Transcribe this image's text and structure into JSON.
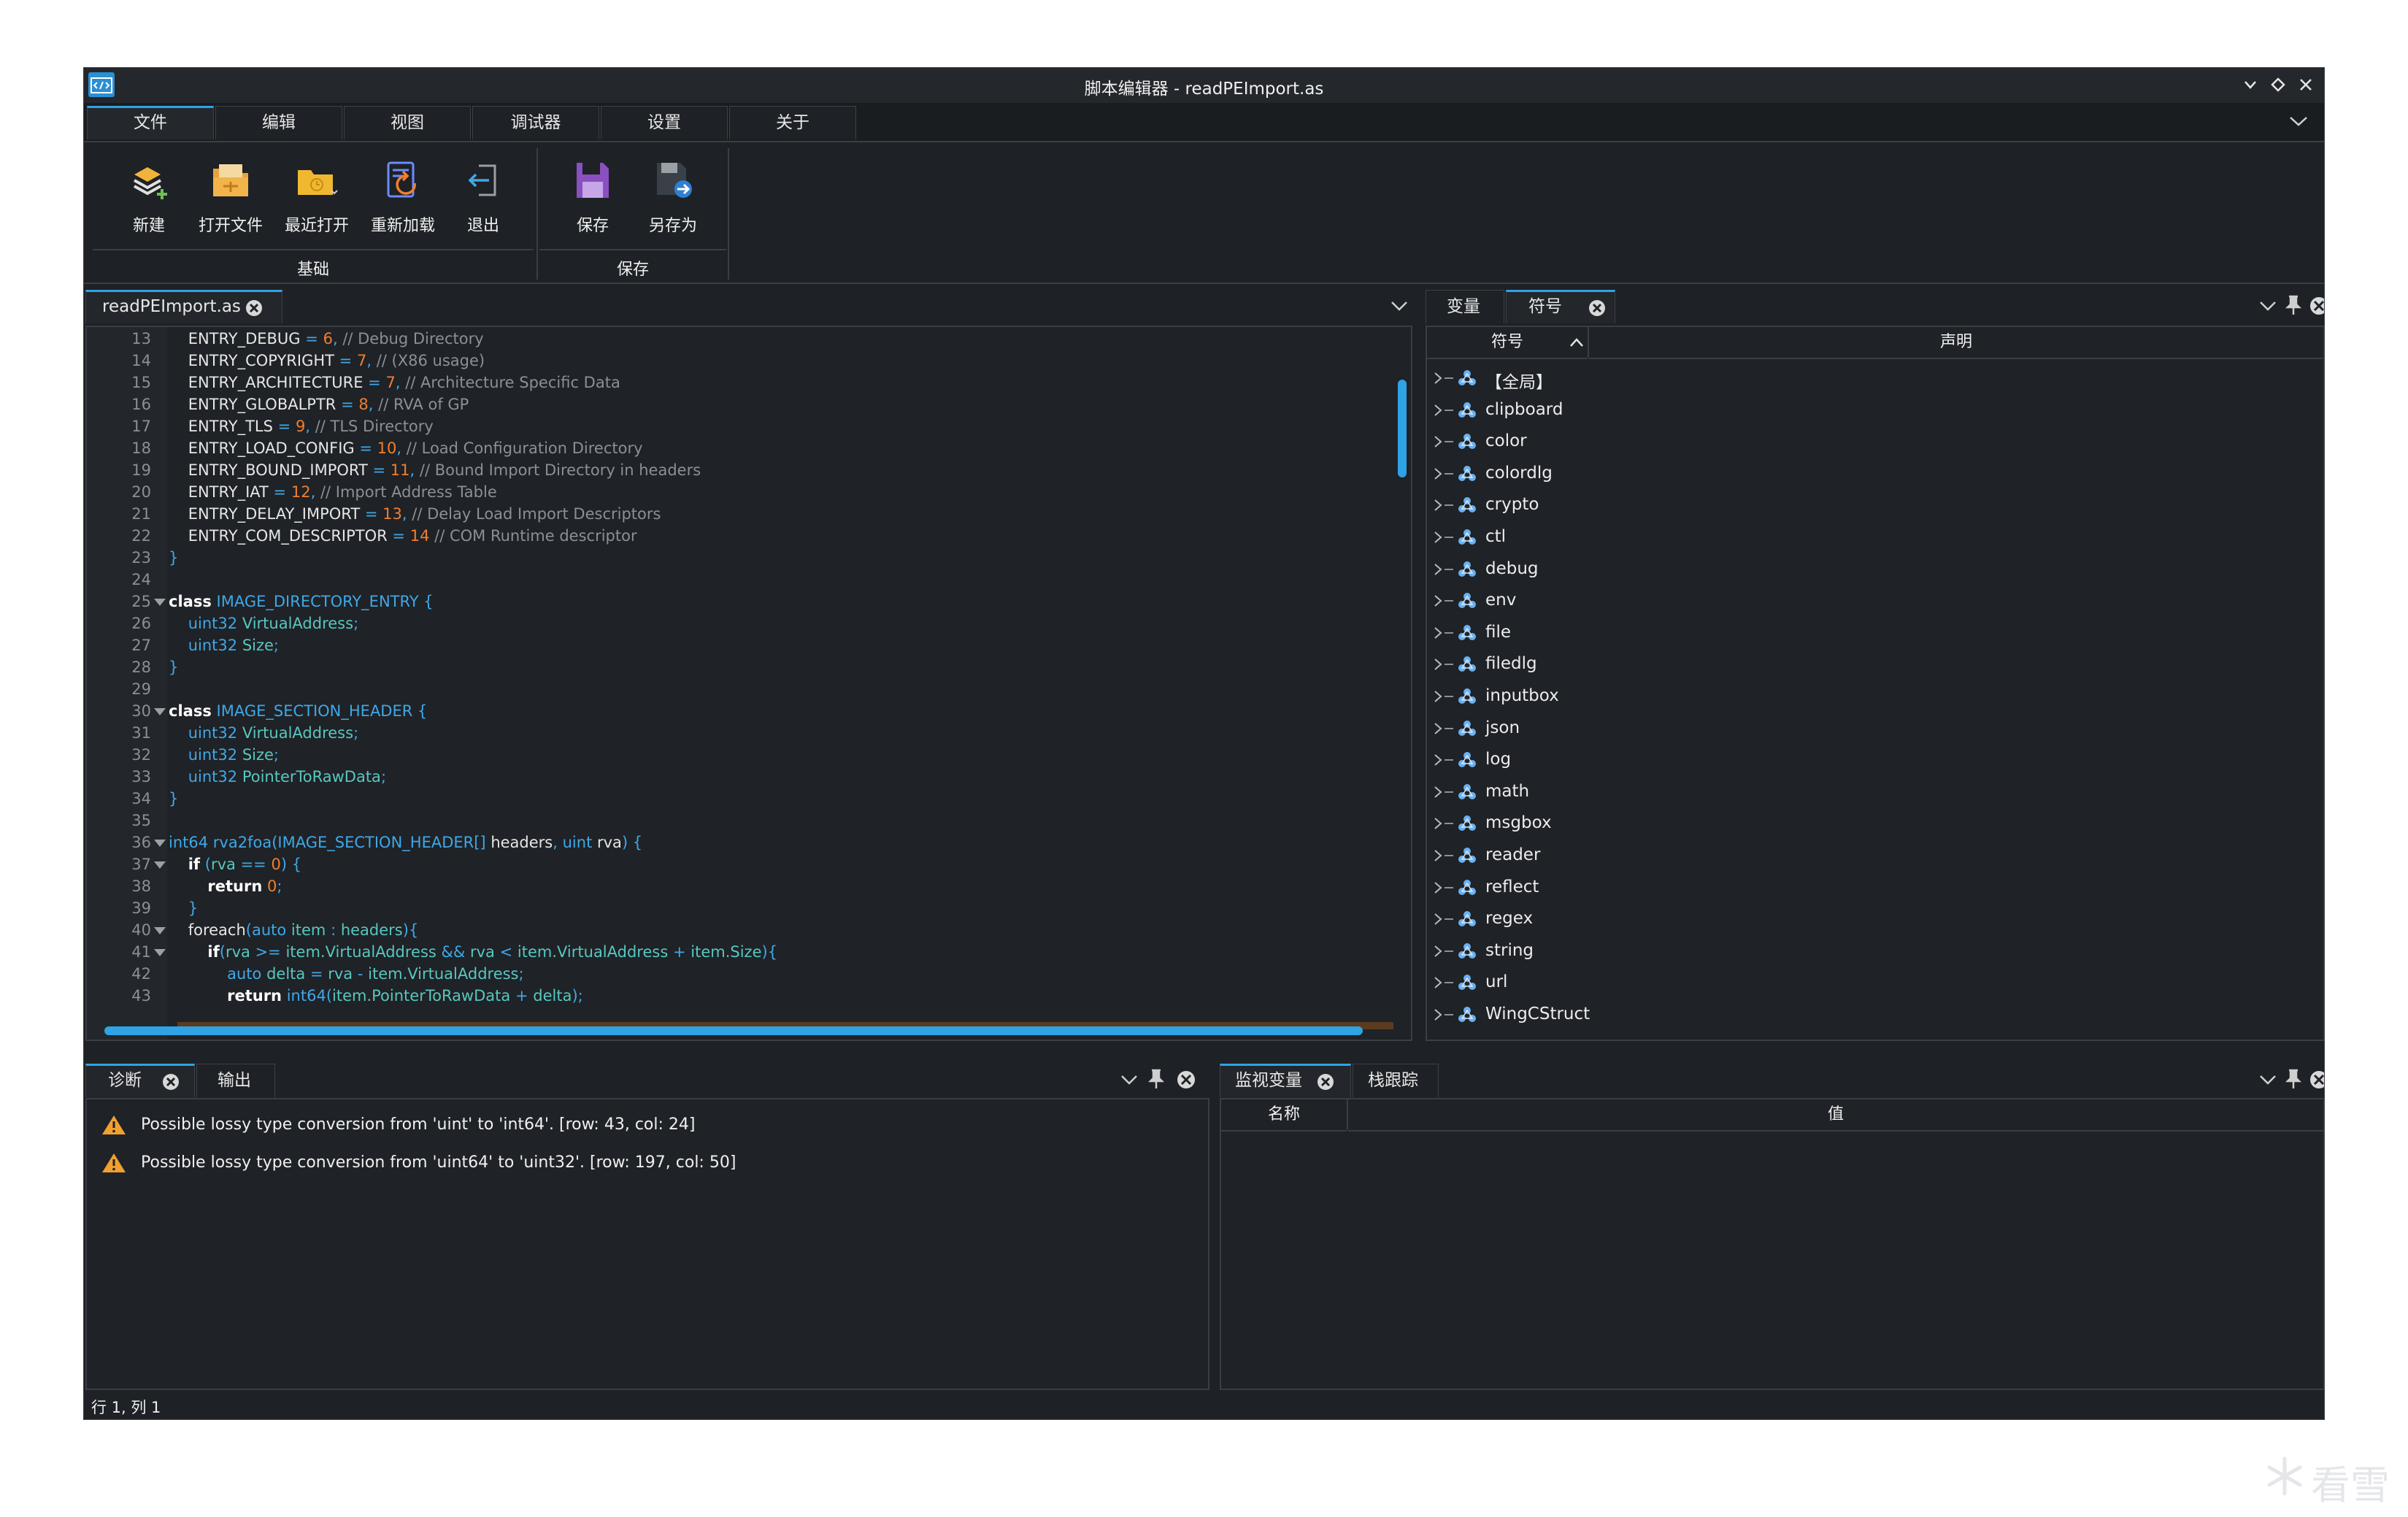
{
  "window": {
    "title": "脚本编辑器 - readPEImport.as"
  },
  "ribbon": {
    "tabs": [
      {
        "label": "文件",
        "active": true
      },
      {
        "label": "编辑"
      },
      {
        "label": "视图"
      },
      {
        "label": "调试器"
      },
      {
        "label": "设置"
      },
      {
        "label": "关于"
      }
    ],
    "buttons": {
      "new": "新建",
      "open": "打开文件",
      "recent": "最近打开",
      "reload": "重新加载",
      "exit": "退出",
      "save": "保存",
      "save_as": "另存为"
    },
    "groups": {
      "basic": "基础",
      "save": "保存"
    }
  },
  "editor": {
    "tab_label": "readPEImport.as",
    "line_numbers": [
      "13",
      "14",
      "15",
      "16",
      "17",
      "18",
      "19",
      "20",
      "21",
      "22",
      "23",
      "24",
      "25",
      "26",
      "27",
      "28",
      "29",
      "30",
      "31",
      "32",
      "33",
      "34",
      "35",
      "36",
      "37",
      "38",
      "39",
      "40",
      "41",
      "42",
      "43"
    ]
  },
  "symbols": {
    "tabs": [
      "变量",
      "符号"
    ],
    "columns": {
      "symbol": "符号",
      "declaration": "声明"
    },
    "items": [
      "【全局】",
      "clipboard",
      "color",
      "colordlg",
      "crypto",
      "ctl",
      "debug",
      "env",
      "file",
      "filedlg",
      "inputbox",
      "json",
      "log",
      "math",
      "msgbox",
      "reader",
      "reflect",
      "regex",
      "string",
      "url",
      "WingCStruct"
    ]
  },
  "diagnostics": {
    "tabs": [
      "诊断",
      "输出"
    ],
    "messages": [
      "Possible lossy type conversion from 'uint' to 'int64'. [row: 43, col: 24]",
      "Possible lossy type conversion from 'uint64' to 'uint32'. [row: 197, col: 50]"
    ]
  },
  "watch": {
    "tabs": [
      "监视变量",
      "栈跟踪"
    ],
    "columns": {
      "name": "名称",
      "value": "值"
    }
  },
  "status": {
    "position": "行 1, 列 1"
  },
  "watermark": "看雪",
  "colors": {
    "accent": "#2fa3e6",
    "background": "#1e2125",
    "warning": "#f0a030"
  }
}
